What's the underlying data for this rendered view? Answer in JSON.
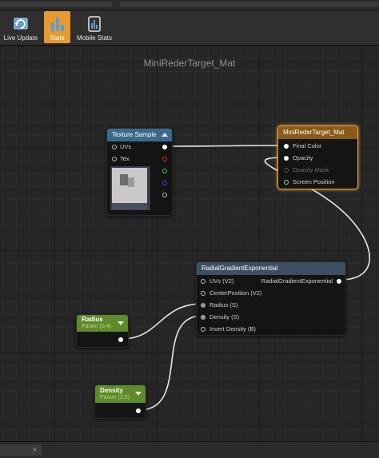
{
  "toolbar": {
    "buttons": [
      {
        "label": "Live Update",
        "icon": "live-update-icon",
        "active": false
      },
      {
        "label": "Stats",
        "icon": "stats-icon",
        "active": true
      },
      {
        "label": "Mobile Stats",
        "icon": "mobile-stats-icon",
        "active": false
      }
    ]
  },
  "graph": {
    "title": "MiniRederTarget_Mat"
  },
  "nodes": {
    "texture_sample": {
      "title": "Texture Sample",
      "header_color": "#3a6a8c",
      "inputs": [
        "UVs",
        "Tex"
      ]
    },
    "material_output": {
      "title": "MiniRederTarget_Mat",
      "header_color": "#8a5a18",
      "inputs": [
        "Final Color",
        "Opacity",
        "Opacity Mask",
        "Screen Position"
      ]
    },
    "radial_gradient": {
      "title": "RadialGradientExponential",
      "header_color": "#3d4f63",
      "inputs": [
        "UVs (V2)",
        "CenterPosition (V2)",
        "Radius (S)",
        "Density (S)",
        "Invert Density (B)"
      ],
      "output": "RadialGradientExponential"
    },
    "radius_param": {
      "title": "Radius",
      "subtitle": "Param (0.4)",
      "header_color": "#5e8a2a"
    },
    "density_param": {
      "title": "Density",
      "subtitle": "Param (2.5)",
      "header_color": "#5e8a2a"
    }
  },
  "colors": {
    "accent": "#e79a2f",
    "selected_border": "#e8a13a"
  }
}
